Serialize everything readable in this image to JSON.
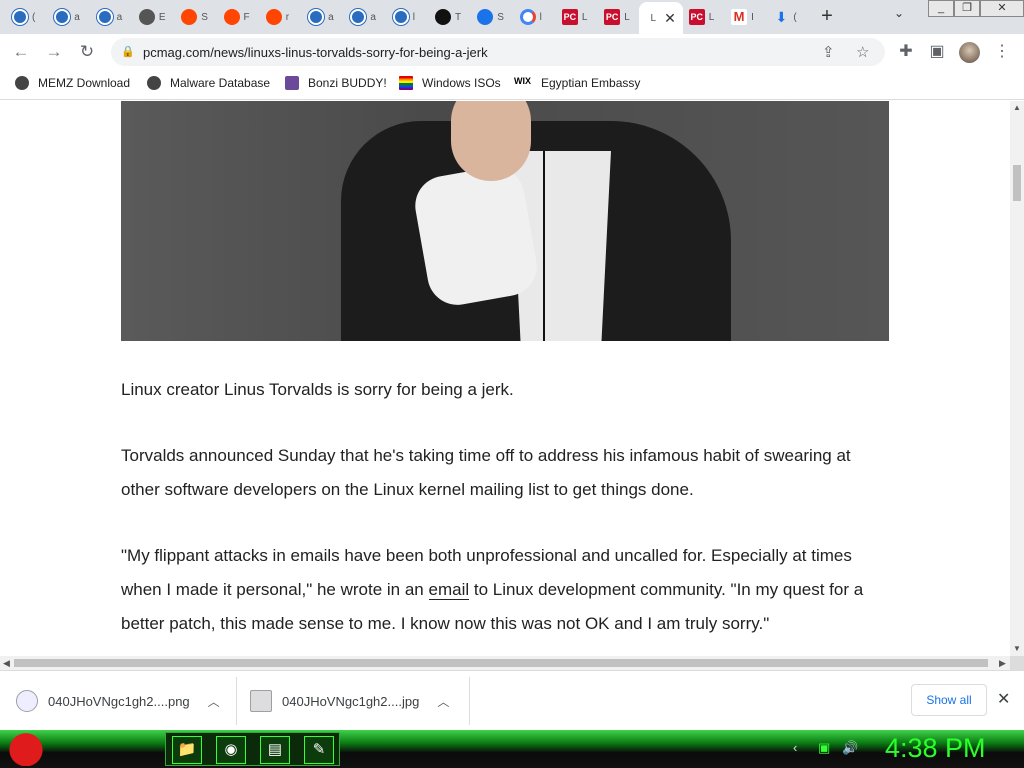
{
  "browser": {
    "tabs": [
      {
        "icon": "edge-icon",
        "label": "("
      },
      {
        "icon": "edge-icon",
        "label": "a"
      },
      {
        "icon": "edge-icon",
        "label": "a"
      },
      {
        "icon": "globe-icon",
        "label": "E"
      },
      {
        "icon": "reddit-icon",
        "label": "S"
      },
      {
        "icon": "reddit-icon",
        "label": "F"
      },
      {
        "icon": "reddit-icon",
        "label": "r"
      },
      {
        "icon": "edge-icon",
        "label": "a"
      },
      {
        "icon": "edge-icon",
        "label": "a"
      },
      {
        "icon": "edge-icon",
        "label": "l"
      },
      {
        "icon": "tiktok-icon",
        "label": "T"
      },
      {
        "icon": "gear-icon",
        "label": "S"
      },
      {
        "icon": "google-icon",
        "label": "l"
      },
      {
        "icon": "pcmag-icon",
        "label": "L"
      },
      {
        "icon": "pcmag-icon",
        "label": "L"
      },
      {
        "icon": "blank-icon",
        "label": "L",
        "active": true
      },
      {
        "icon": "pcmag-icon",
        "label": "L"
      },
      {
        "icon": "gmail-icon",
        "label": "I"
      },
      {
        "icon": "download-icon",
        "label": "("
      }
    ],
    "new_tab": "+",
    "url": "pcmag.com/news/linuxs-linus-torvalds-sorry-for-being-a-jerk"
  },
  "bookmarks": [
    {
      "icon": "globe",
      "label": "MEMZ Download"
    },
    {
      "icon": "globe",
      "label": "Malware Database"
    },
    {
      "icon": "bonzi",
      "label": "Bonzi BUDDY!"
    },
    {
      "icon": "rainbow",
      "label": "Windows ISOs"
    },
    {
      "icon": "wix",
      "label": "Egyptian Embassy"
    }
  ],
  "article": {
    "p1": "Linux creator Linus Torvalds is sorry for being a jerk.",
    "p2": "Torvalds announced Sunday that he's taking time off to address his infamous habit of swearing at other software developers on the Linux kernel mailing list to get things done.",
    "p3_before": "\"My flippant attacks in emails have been both unprofessional and uncalled for. Especially at times when I made it personal,\" he wrote in an ",
    "p3_link": "email",
    "p3_after": " to Linux development community. \"In my quest for a better patch, this made sense to me. I know now this was not OK and I am truly sorry.\""
  },
  "downloads": {
    "items": [
      "040JHoVNgc1gh2....png",
      "040JHoVNgc1gh2....jpg"
    ],
    "show_all": "Show all"
  },
  "taskbar": {
    "clock": "4:38 PM"
  },
  "colors": {
    "clock": "#2bff2b",
    "link": "#1a73e8"
  }
}
